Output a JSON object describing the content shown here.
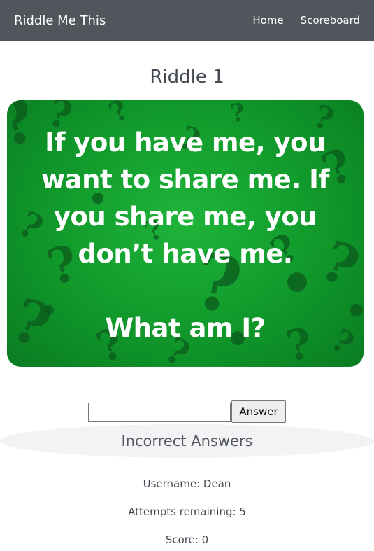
{
  "navbar": {
    "brand": "Riddle Me This",
    "links": [
      "Home",
      "Scoreboard"
    ]
  },
  "riddle": {
    "title": "Riddle 1",
    "image_text": "If you have me, you\nwant to share me. If\nyou share me, you\ndon’t have me.\n\nWhat am I?",
    "colors": {
      "background": "#15a530",
      "marks": "#0b5a1c"
    }
  },
  "answer_form": {
    "input_value": "",
    "button_label": "Answer"
  },
  "incorrect": {
    "heading": "Incorrect Answers"
  },
  "stats": {
    "username": "Username: Dean",
    "attempts": "Attempts remaining: 5",
    "score": "Score: 0"
  }
}
